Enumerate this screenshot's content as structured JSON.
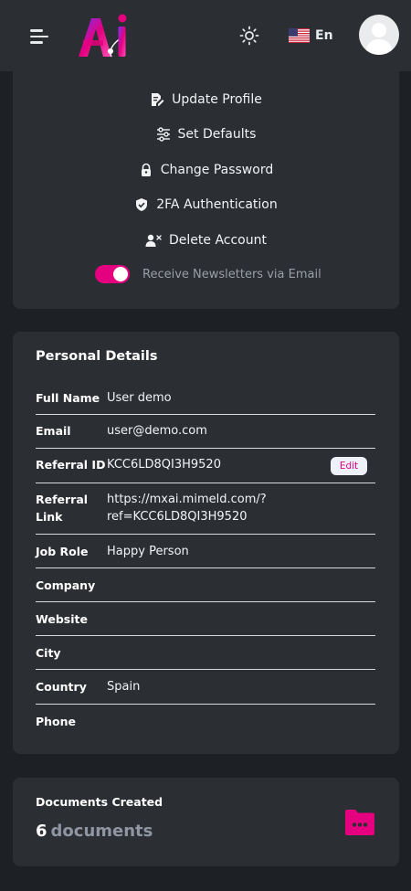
{
  "header": {
    "logo_text": "Ai",
    "language_label": "En",
    "colors": {
      "brand": "#e4007f",
      "brand_alt": "#7b2ff7"
    },
    "icons": [
      "hamburger-menu-icon",
      "sun-icon",
      "us-flag-icon",
      "user-avatar-icon"
    ]
  },
  "menu": {
    "items": [
      {
        "label": "Update Profile",
        "icon": "edit-document-icon"
      },
      {
        "label": "Set Defaults",
        "icon": "sliders-icon"
      },
      {
        "label": "Change Password",
        "icon": "lock-icon"
      },
      {
        "label": "2FA Authentication",
        "icon": "shield-check-icon"
      },
      {
        "label": "Delete Account",
        "icon": "user-remove-icon"
      }
    ],
    "newsletter_label": "Receive Newsletters via Email",
    "newsletter_enabled": true
  },
  "personal": {
    "title": "Personal Details",
    "rows": [
      {
        "label": "Full Name",
        "value": "User demo"
      },
      {
        "label": "Email",
        "value": "user@demo.com"
      },
      {
        "label": "Referral ID",
        "value": "KCC6LD8QI3H9520",
        "action": "Edit"
      },
      {
        "label_line1": "Referral",
        "label_line2": "Link",
        "value_line1": "https://mxai.mimeld.com/?",
        "value_line2": "ref=KCC6LD8QI3H9520"
      },
      {
        "label": "Job Role",
        "value": "Happy Person"
      },
      {
        "label": "Company",
        "value": ""
      },
      {
        "label": "Website",
        "value": ""
      },
      {
        "label": "City",
        "value": ""
      },
      {
        "label": "Country",
        "value": "Spain"
      },
      {
        "label": "Phone",
        "value": ""
      }
    ]
  },
  "documents": {
    "title": "Documents Created",
    "count": "6",
    "unit": "documents",
    "icon": "folder-icon"
  }
}
